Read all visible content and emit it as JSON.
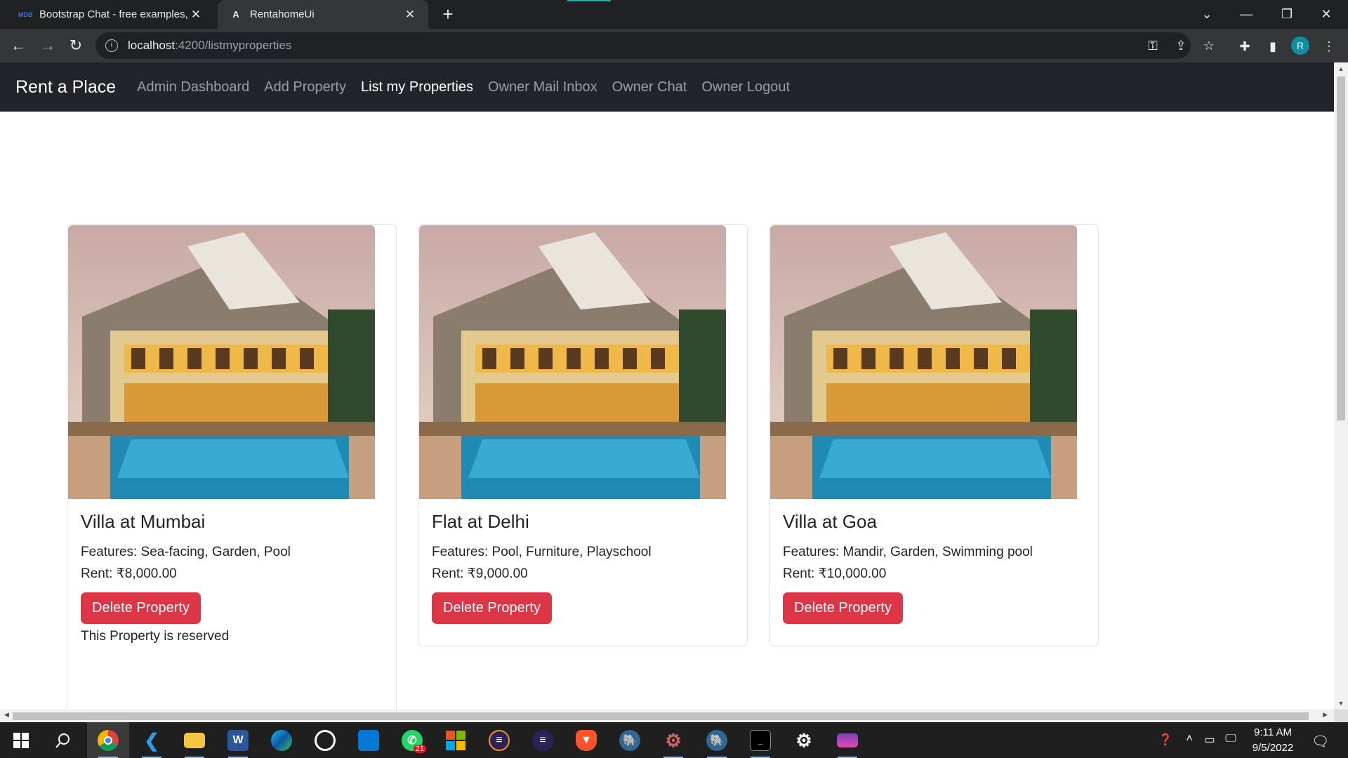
{
  "browser": {
    "tabs": [
      {
        "favicon": "MDB",
        "title": "Bootstrap Chat - free examples, t"
      },
      {
        "favicon": "A",
        "title": "RentahomeUi"
      }
    ],
    "url_host": "localhost",
    "url_path": ":4200/listmyproperties",
    "profile_initial": "R"
  },
  "navbar": {
    "brand": "Rent a Place",
    "links": [
      "Admin Dashboard",
      "Add Property",
      "List my Properties",
      "Owner Mail Inbox",
      "Owner Chat",
      "Owner Logout"
    ],
    "active_link": "List my Properties"
  },
  "properties": [
    {
      "title": "Villa at Mumbai",
      "features": "Features: Sea-facing, Garden, Pool",
      "rent": "Rent: ₹8,000.00",
      "button": "Delete Property",
      "status": "This Property is reserved"
    },
    {
      "title": "Flat at Delhi",
      "features": "Features: Pool, Furniture, Playschool",
      "rent": "Rent: ₹9,000.00",
      "button": "Delete Property",
      "status": ""
    },
    {
      "title": "Villa at Goa",
      "features": "Features: Mandir, Garden, Swimming pool",
      "rent": "Rent: ₹10,000.00",
      "button": "Delete Property",
      "status": ""
    }
  ],
  "taskbar": {
    "whatsapp_badge": "21",
    "time": "9:11 AM",
    "date": "9/5/2022"
  },
  "colors": {
    "navbar_bg": "#212529",
    "danger": "#dc3545",
    "chrome_dark": "#202124",
    "chrome_toolbar": "#35363a"
  }
}
